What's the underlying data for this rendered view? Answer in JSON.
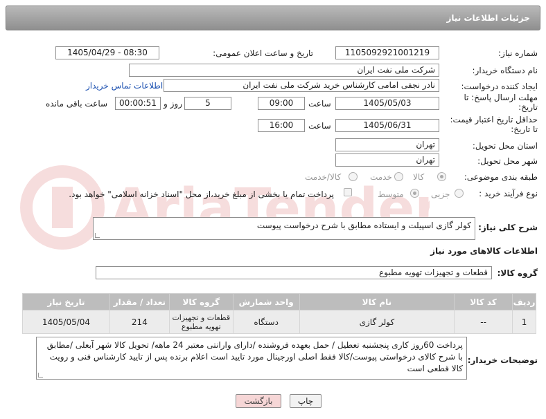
{
  "header": {
    "title": "جزئیات اطلاعات نیاز"
  },
  "fields": {
    "need_number_label": "شماره نیاز:",
    "need_number": "1105092921001219",
    "announce_label": "تاریخ و ساعت اعلان عمومی:",
    "announce_value": "1405/04/29 - 08:30",
    "buyer_org_label": "نام دستگاه خریدار:",
    "buyer_org": "شرکت ملی نفت ایران",
    "creator_label": "ایجاد کننده درخواست:",
    "creator": "نادر نجفی امامی کارشناس خرید شرکت ملی نفت ایران",
    "contact_link": "اطلاعات تماس خریدار",
    "deadline_label": "مهلت ارسال پاسخ: تا تاریخ:",
    "deadline_date": "1405/05/03",
    "time_word": "ساعت",
    "deadline_time": "09:00",
    "days_value": "5",
    "days_word": "روز و",
    "remaining_time": "00:00:51",
    "remaining_word": "ساعت باقی مانده",
    "price_validity_label": "حداقل تاریخ اعتبار قیمت: تا تاریخ:",
    "price_date": "1405/06/31",
    "price_time": "16:00",
    "province_label": "استان محل تحویل:",
    "province": "تهران",
    "city_label": "شهر محل تحویل:",
    "city": "تهران",
    "category_label": "طبقه بندی موضوعی:",
    "category_options": [
      "کالا",
      "خدمت",
      "کالا/خدمت"
    ],
    "process_label": "نوع فرآیند خرید :",
    "process_options": [
      "جزیی",
      "متوسط"
    ],
    "payment_note": "پرداخت تمام یا بخشی از مبلغ خرید،از محل \"اسناد خزانه اسلامی\" خواهد بود.",
    "description_label": "شرح کلی نیاز:",
    "description": "کولر گازی اسپیلت و ایستاده مطابق با شرح درخواست پیوست",
    "items_section": "اطلاعات کالاهای مورد نیاز",
    "group_label": "گروه کالا:",
    "group_value": "قطعات و تجهیزات تهویه مطبوع"
  },
  "table": {
    "headers": [
      "ردیف",
      "کد کالا",
      "نام کالا",
      "واحد شمارش",
      "گروه کالا",
      "تعداد / مقدار",
      "تاریخ نیاز"
    ],
    "rows": [
      [
        "1",
        "--",
        "کولر گازی",
        "دستگاه",
        "قطعات و تجهیزات تهویه مطبوع",
        "214",
        "1405/05/04"
      ]
    ]
  },
  "buyer_notes": {
    "label": "توضیحات خریدار:",
    "text": "پرداخت 60روز کاری پنجشنبه تعطیل / حمل بعهده فروشنده /دارای وارانتی معتبر 24 ماهه/ تحویل کالا شهر آبعلی /مطابق با شرح کالای  درخواستی پیوست/کالا فقط اصلی اورجینال مورد تایید است اعلام برنده پس از تایید کارشناس فنی و رویت کالا قطعی است"
  },
  "buttons": {
    "print": "چاپ",
    "back": "بازگشت"
  },
  "colors": {
    "titlebar": "#9e9e9e",
    "table_header": "#bdbdbd",
    "link": "#1a4fb0",
    "back_button": "#f6d6d6"
  }
}
